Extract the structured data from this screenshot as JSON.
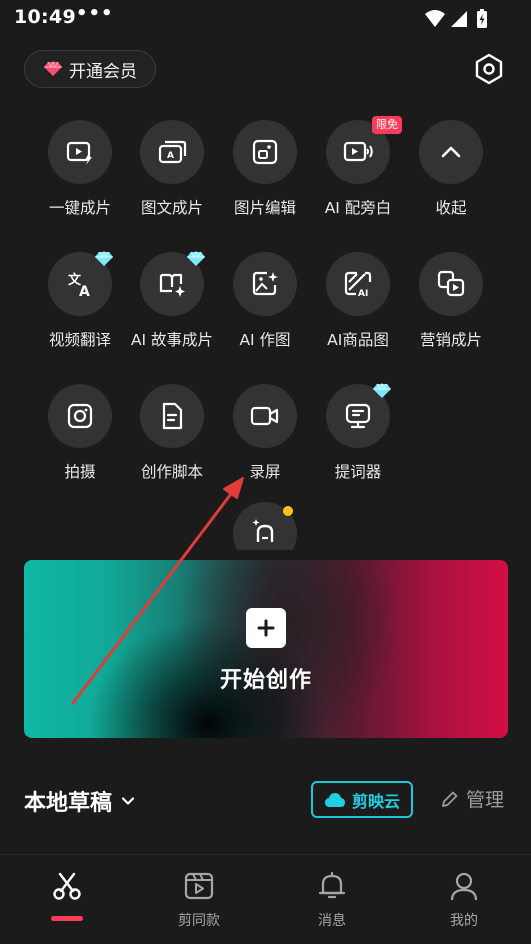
{
  "status": {
    "time": "10:49",
    "dots": "•••"
  },
  "header": {
    "vip_label": "开通会员"
  },
  "tools": [
    {
      "label": "一键成片",
      "icon": "one-click-video-icon"
    },
    {
      "label": "图文成片",
      "icon": "text-to-video-icon"
    },
    {
      "label": "图片编辑",
      "icon": "image-edit-icon"
    },
    {
      "label": "AI 配旁白",
      "icon": "ai-narration-icon",
      "badge": "限免"
    },
    {
      "label": "收起",
      "icon": "chevron-up-icon"
    },
    {
      "label": "视频翻译",
      "icon": "video-translate-icon"
    },
    {
      "label": "AI 故事成片",
      "icon": "ai-story-icon"
    },
    {
      "label": "AI 作图",
      "icon": "ai-image-icon"
    },
    {
      "label": "AI商品图",
      "icon": "ai-product-image-icon"
    },
    {
      "label": "营销成片",
      "icon": "marketing-video-icon"
    },
    {
      "label": "拍摄",
      "icon": "camera-icon"
    },
    {
      "label": "创作脚本",
      "icon": "script-icon"
    },
    {
      "label": "录屏",
      "icon": "screen-record-icon"
    },
    {
      "label": "提词器",
      "icon": "teleprompter-icon"
    }
  ],
  "create": {
    "label": "开始创作"
  },
  "drafts": {
    "title": "本地草稿",
    "cloud_label": "剪映云",
    "manage_label": "管理"
  },
  "nav": [
    {
      "label": "",
      "icon": "scissors-icon",
      "active": true
    },
    {
      "label": "剪同款",
      "icon": "template-icon"
    },
    {
      "label": "消息",
      "icon": "bell-icon"
    },
    {
      "label": "我的",
      "icon": "profile-icon"
    }
  ],
  "colors": {
    "background": "#1b1b1b",
    "accent_red": "#ff3b5c",
    "cloud_cyan": "#1fc8d8",
    "tool_bg": "#333333"
  }
}
